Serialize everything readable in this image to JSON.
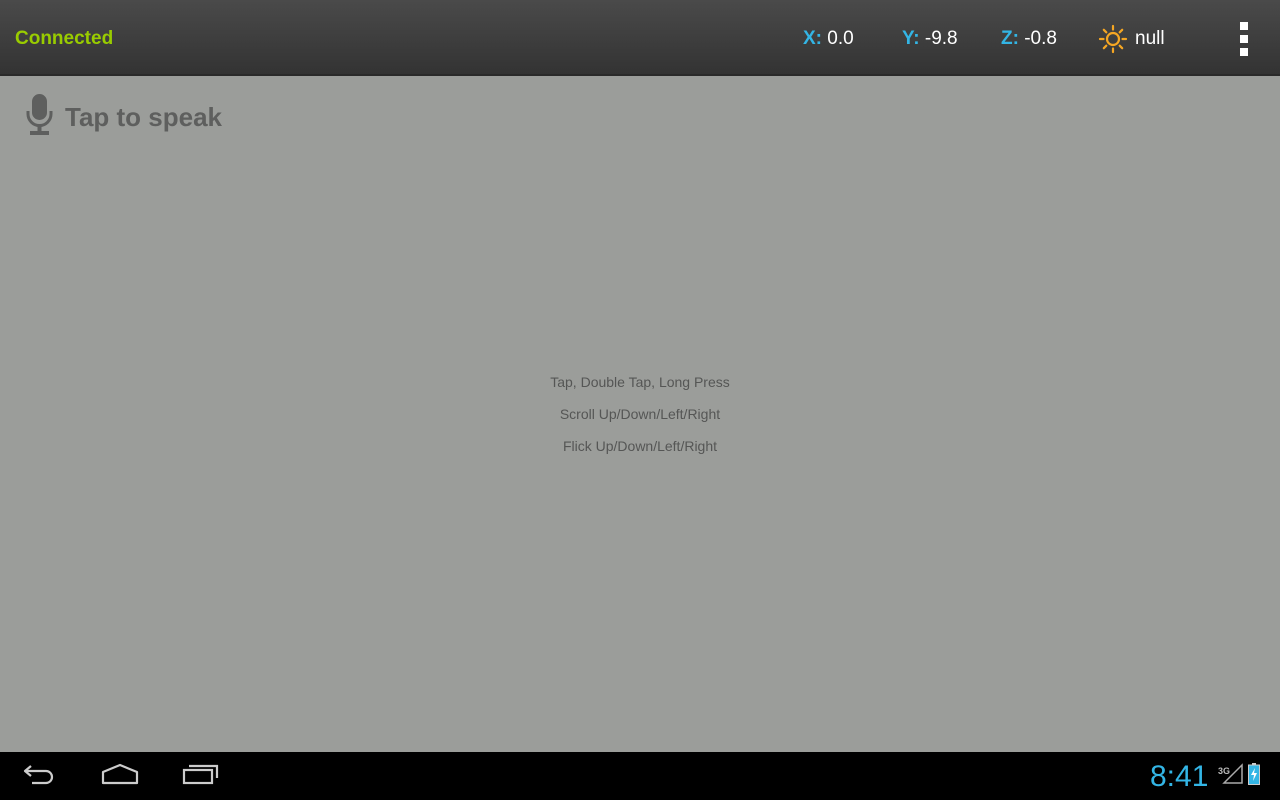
{
  "status": {
    "connection": "Connected"
  },
  "sensors": {
    "x": {
      "label": "X:",
      "value": "0.0"
    },
    "y": {
      "label": "Y:",
      "value": "-9.8"
    },
    "z": {
      "label": "Z:",
      "value": "-0.8"
    },
    "light": {
      "icon": "sun-icon",
      "value": "null"
    }
  },
  "content": {
    "speak_label": "Tap to speak",
    "gestures": [
      "Tap, Double Tap, Long Press",
      "Scroll Up/Down/Left/Right",
      "Flick Up/Down/Left/Right"
    ]
  },
  "system_bar": {
    "time": "8:41",
    "network_type": "3G"
  },
  "colors": {
    "accent": "#33b5e5",
    "connected": "#99cc00",
    "light_icon": "#f5a623"
  }
}
